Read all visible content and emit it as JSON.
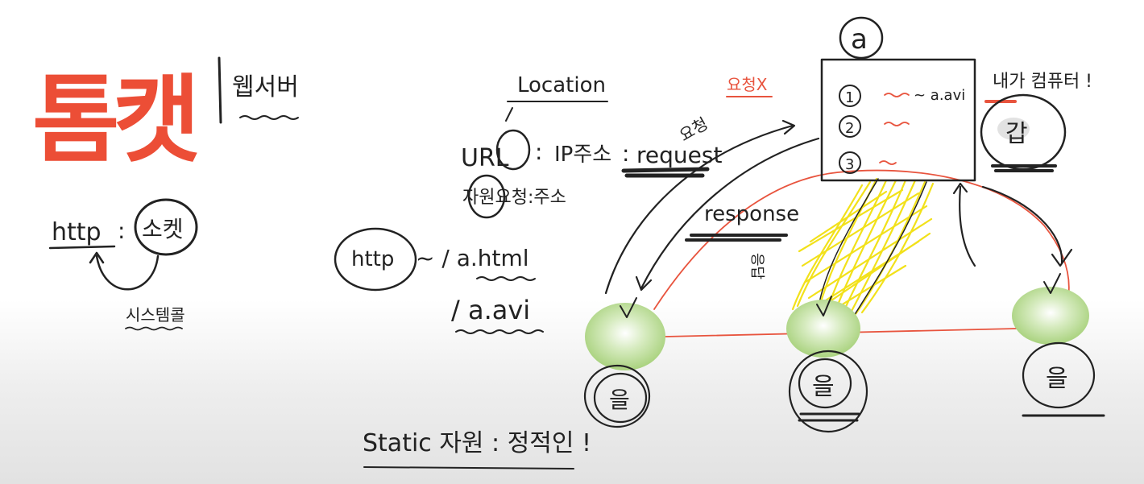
{
  "left": {
    "logo_text": "톰캣",
    "subtitle": "웹서버",
    "http_label": "http",
    "http_circle": "소켓",
    "arrow_note": "시스템콜"
  },
  "middle": {
    "location": "Location",
    "url": "URL",
    "ip": "IP주소",
    "request": "request",
    "resource_addr": "자원요청:주소",
    "http": "http",
    "path1": "~ / a.html",
    "path2": "/ a.avi",
    "static_note": "Static 자원 : 정적인 !"
  },
  "server": {
    "label": "a",
    "items": [
      {
        "num": "1",
        "text": "~ a.avi"
      },
      {
        "num": "2",
        "text": "~"
      },
      {
        "num": "3",
        "text": "~"
      }
    ],
    "request_note": "요청",
    "response": "response",
    "response_ko": "응답",
    "red_note": "요청X"
  },
  "right": {
    "note": "내가 컴퓨터 !",
    "circle_text": "갑"
  },
  "clients": {
    "label": "을"
  },
  "colors": {
    "ink": "#222222",
    "red": "#e8543e",
    "green": "#a9d27e",
    "yellow": "#f2e11a"
  }
}
